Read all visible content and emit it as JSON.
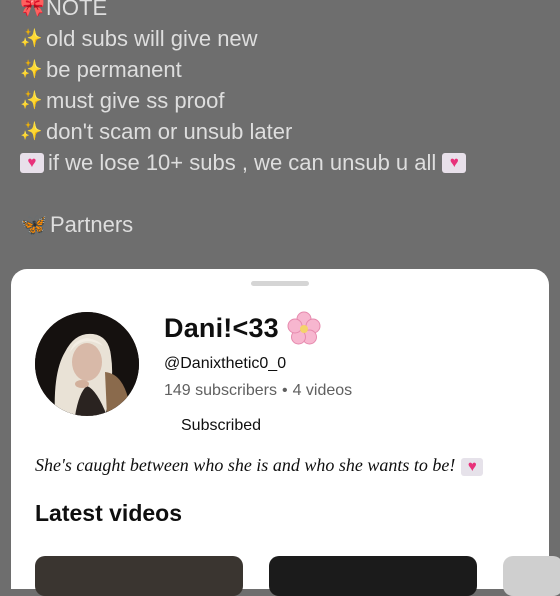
{
  "background_post": {
    "lines": [
      {
        "icon": "bow-icon",
        "text": "NOTE"
      },
      {
        "icon": "sparkles-icon",
        "text": "old subs will give new"
      },
      {
        "icon": "sparkles-icon",
        "text": "be permanent"
      },
      {
        "icon": "sparkles-icon",
        "text": "must give ss proof"
      },
      {
        "icon": "sparkles-icon",
        "text": "don't scam or unsub later"
      },
      {
        "icon": "heart-letter-icon",
        "text": "if we lose 10+ subs , we can unsub u all"
      },
      {
        "icon": "butterfly-icon",
        "text": "Partners"
      }
    ]
  },
  "channel_sheet": {
    "name": "Dani!<33",
    "name_icon": "cherry-blossom-icon",
    "handle": "@Danixthetic0_0",
    "subscribers": "149 subscribers",
    "separator": "•",
    "videos": "4 videos",
    "subscribe_label": "Subscribed",
    "description": "She's caught between who she is and who she wants to be!",
    "description_icon": "heart-letter-icon",
    "latest_videos_title": "Latest videos"
  },
  "colors": {
    "scrim": "#6e6e6e",
    "sheet": "#ffffff",
    "secondary_text": "#606060",
    "primary_text": "#0f0f0f"
  }
}
